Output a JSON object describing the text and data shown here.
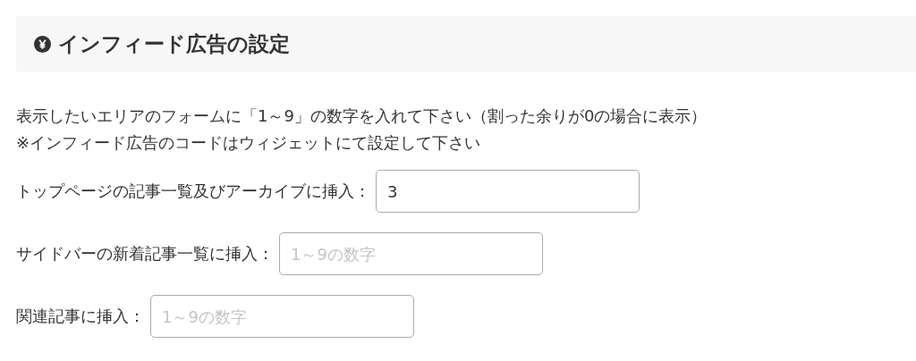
{
  "section": {
    "title": "インフィード広告の設定"
  },
  "description": [
    "表示したいエリアのフォームに「1～9」の数字を入れて下さい（割った余りが0の場合に表示）",
    "※インフィード広告のコードはウィジェットにて設定して下さい"
  ],
  "fields": [
    {
      "label": "トップページの記事一覧及びアーカイブに挿入：",
      "value": "3"
    },
    {
      "label": "サイドバーの新着記事一覧に挿入：",
      "placeholder": "1～9の数字"
    },
    {
      "label": "関連記事に挿入：",
      "placeholder": "1～9の数字"
    }
  ]
}
